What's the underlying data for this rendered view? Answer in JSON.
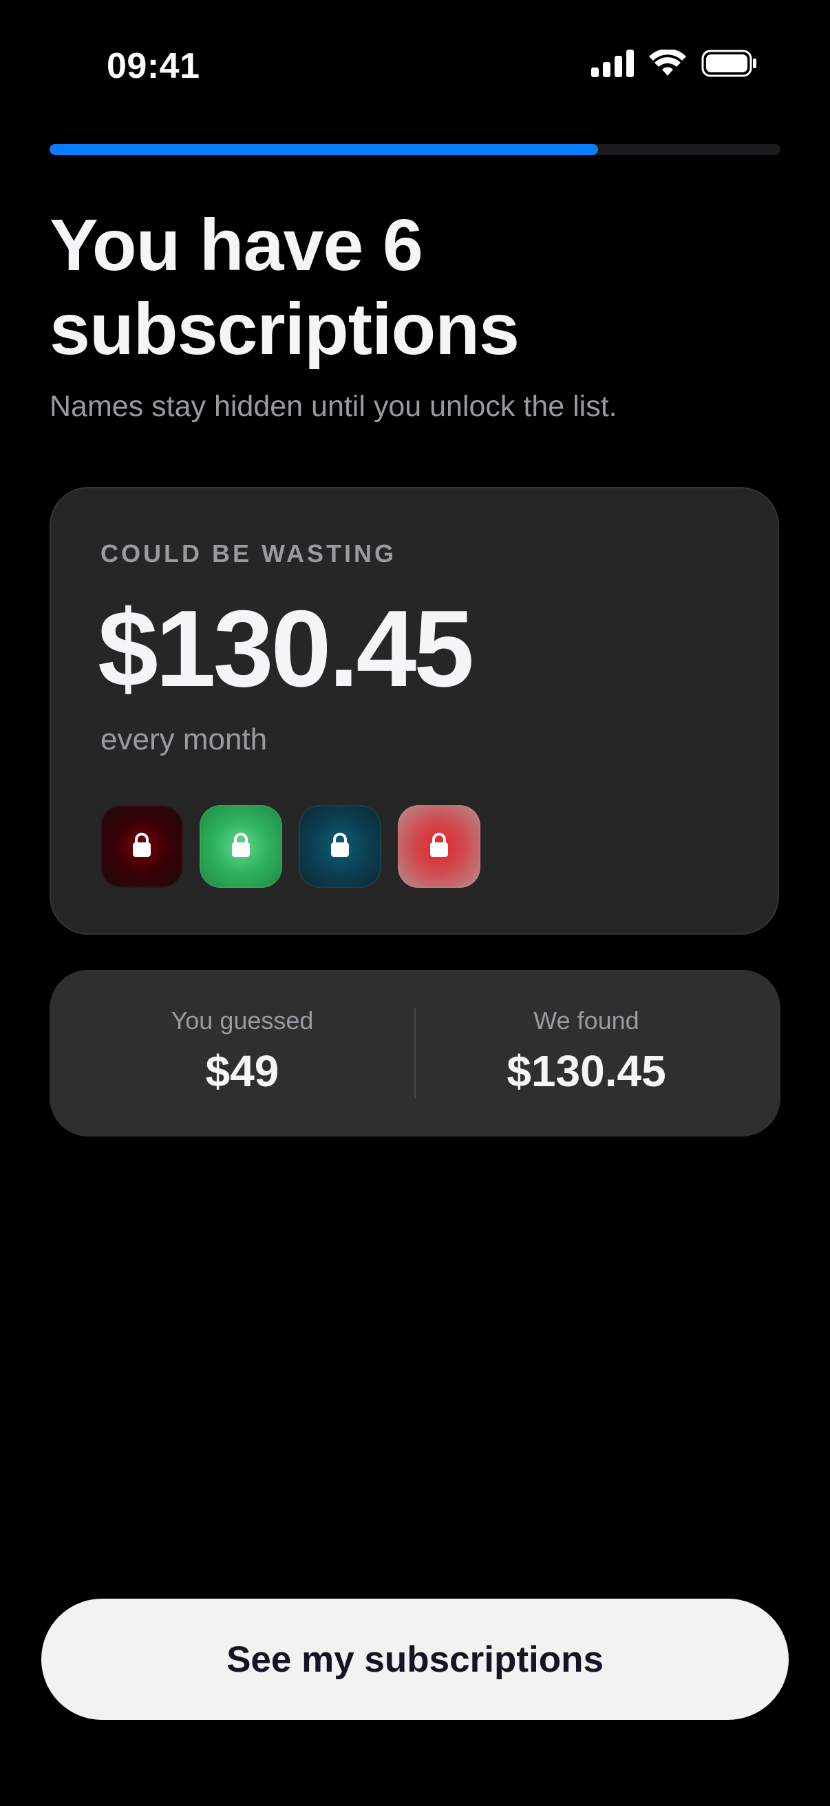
{
  "status_bar": {
    "time": "09:41",
    "icons": [
      "signal-icon",
      "wifi-icon",
      "battery-icon"
    ]
  },
  "progress": {
    "fraction": 0.75,
    "color": "#0a7cff"
  },
  "header": {
    "title": "You have 6 subscriptions",
    "subtitle": "Names stay hidden until you unlock the list."
  },
  "waste_card": {
    "label": "COULD BE WASTING",
    "amount": "$130.45",
    "period": "every month",
    "locked_icons": [
      {
        "name": "lock-icon",
        "color": "#7a0009"
      },
      {
        "name": "lock-icon",
        "color": "#2fb55f"
      },
      {
        "name": "lock-icon",
        "color": "#0b3f52"
      },
      {
        "name": "lock-icon",
        "color": "#e0252d"
      }
    ]
  },
  "comparison": {
    "guessed_label": "You guessed",
    "guessed_value": "$49",
    "found_label": "We found",
    "found_value": "$130.45"
  },
  "cta": {
    "label": "See my subscriptions"
  }
}
